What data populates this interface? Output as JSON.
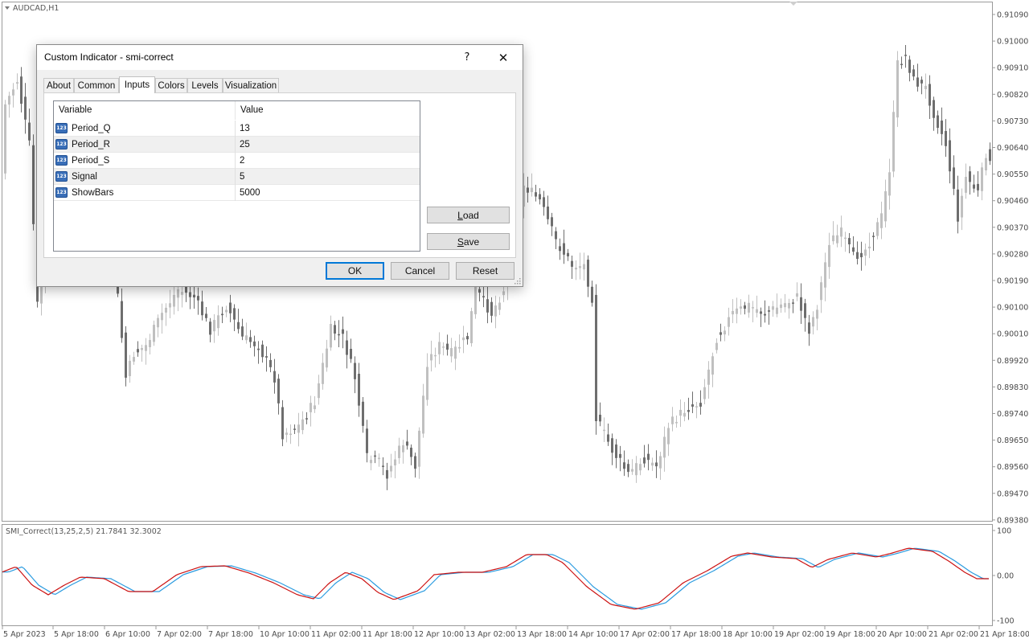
{
  "chart": {
    "symbol_label": "AUDCAD,H1",
    "price_axis": [
      "0.91090",
      "0.91000",
      "0.90910",
      "0.90820",
      "0.90730",
      "0.90640",
      "0.90550",
      "0.90460",
      "0.90370",
      "0.90280",
      "0.90190",
      "0.90100",
      "0.90010",
      "0.89920",
      "0.89830",
      "0.89740",
      "0.89650",
      "0.89560",
      "0.89470",
      "0.89380"
    ],
    "indicator_label": "SMI_Correct(13,25,2,5) 21.7841 32.3002",
    "indicator_axis": [
      "100",
      "0.00",
      "-100"
    ],
    "time_axis": [
      "5 Apr 2023",
      "5 Apr 18:00",
      "6 Apr 10:00",
      "7 Apr 02:00",
      "7 Apr 18:00",
      "10 Apr 10:00",
      "11 Apr 02:00",
      "11 Apr 18:00",
      "12 Apr 10:00",
      "13 Apr 02:00",
      "13 Apr 18:00",
      "14 Apr 10:00",
      "17 Apr 02:00",
      "17 Apr 18:00",
      "18 Apr 10:00",
      "19 Apr 02:00",
      "19 Apr 18:00",
      "20 Apr 10:00",
      "21 Apr 02:00",
      "21 Apr 18:00"
    ],
    "colors": {
      "bull": "#c0c0c0",
      "bear": "#6e6e6e",
      "smi": "#cc1111",
      "signal": "#2a9be0"
    }
  },
  "dialog": {
    "title": "Custom Indicator - smi-correct",
    "help_label": "?",
    "close_label": "✕",
    "tabs": [
      {
        "label": "About",
        "active": false
      },
      {
        "label": "Common",
        "active": false
      },
      {
        "label": "Inputs",
        "active": true
      },
      {
        "label": "Colors",
        "active": false
      },
      {
        "label": "Levels",
        "active": false
      },
      {
        "label": "Visualization",
        "active": false
      }
    ],
    "grid": {
      "headers": [
        "Variable",
        "Value"
      ],
      "rows": [
        {
          "variable": "Period_Q",
          "value": "13"
        },
        {
          "variable": "Period_R",
          "value": "25"
        },
        {
          "variable": "Period_S",
          "value": "2"
        },
        {
          "variable": "Signal",
          "value": "5"
        },
        {
          "variable": "ShowBars",
          "value": "5000"
        }
      ],
      "icon_text": "123"
    },
    "buttons": {
      "load_pre": "",
      "load_u": "L",
      "load_post": "oad",
      "save_pre": "",
      "save_u": "S",
      "save_post": "ave",
      "ok": "OK",
      "cancel": "Cancel",
      "reset": "Reset"
    }
  }
}
